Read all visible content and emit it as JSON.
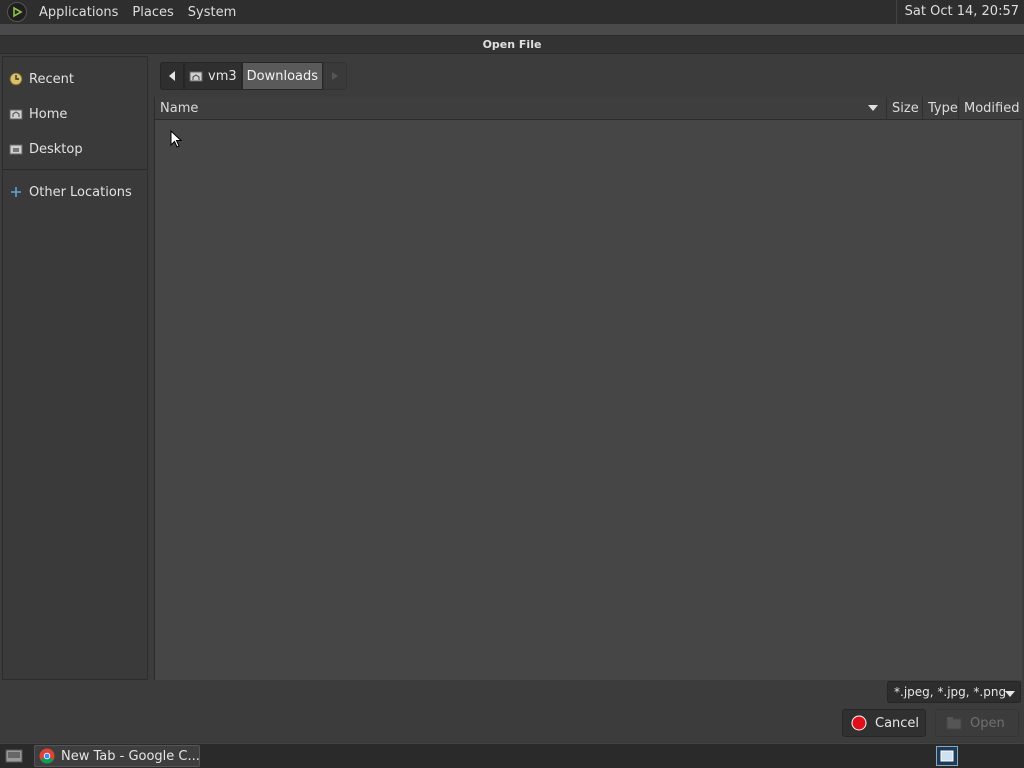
{
  "top_panel": {
    "menus": [
      "Applications",
      "Places",
      "System"
    ],
    "clock": "Sat Oct 14, 20:57"
  },
  "dialog": {
    "title": "Open File",
    "sidebar": {
      "items": [
        {
          "label": "Recent",
          "icon": "recent-icon"
        },
        {
          "label": "Home",
          "icon": "home-icon"
        },
        {
          "label": "Desktop",
          "icon": "desktop-icon"
        },
        {
          "label": "Other Locations",
          "icon": "plus-icon"
        }
      ]
    },
    "pathbar": {
      "home_label": "vm3",
      "current_label": "Downloads"
    },
    "file_list": {
      "columns": [
        "Name",
        "Size",
        "Type",
        "Modified"
      ],
      "rows": []
    },
    "filter": "*.jpeg, *.jpg, *.png",
    "cancel_label": "Cancel",
    "open_label": "Open"
  },
  "taskbar": {
    "items": [
      {
        "label": "New Tab - Google C...",
        "icon": "chrome-icon"
      }
    ]
  },
  "colors": {
    "panel_bg": "#2e2e2e",
    "dialog_bg": "#3c3c3c",
    "list_bg": "#464646",
    "cancel_red": "#e0101a"
  }
}
